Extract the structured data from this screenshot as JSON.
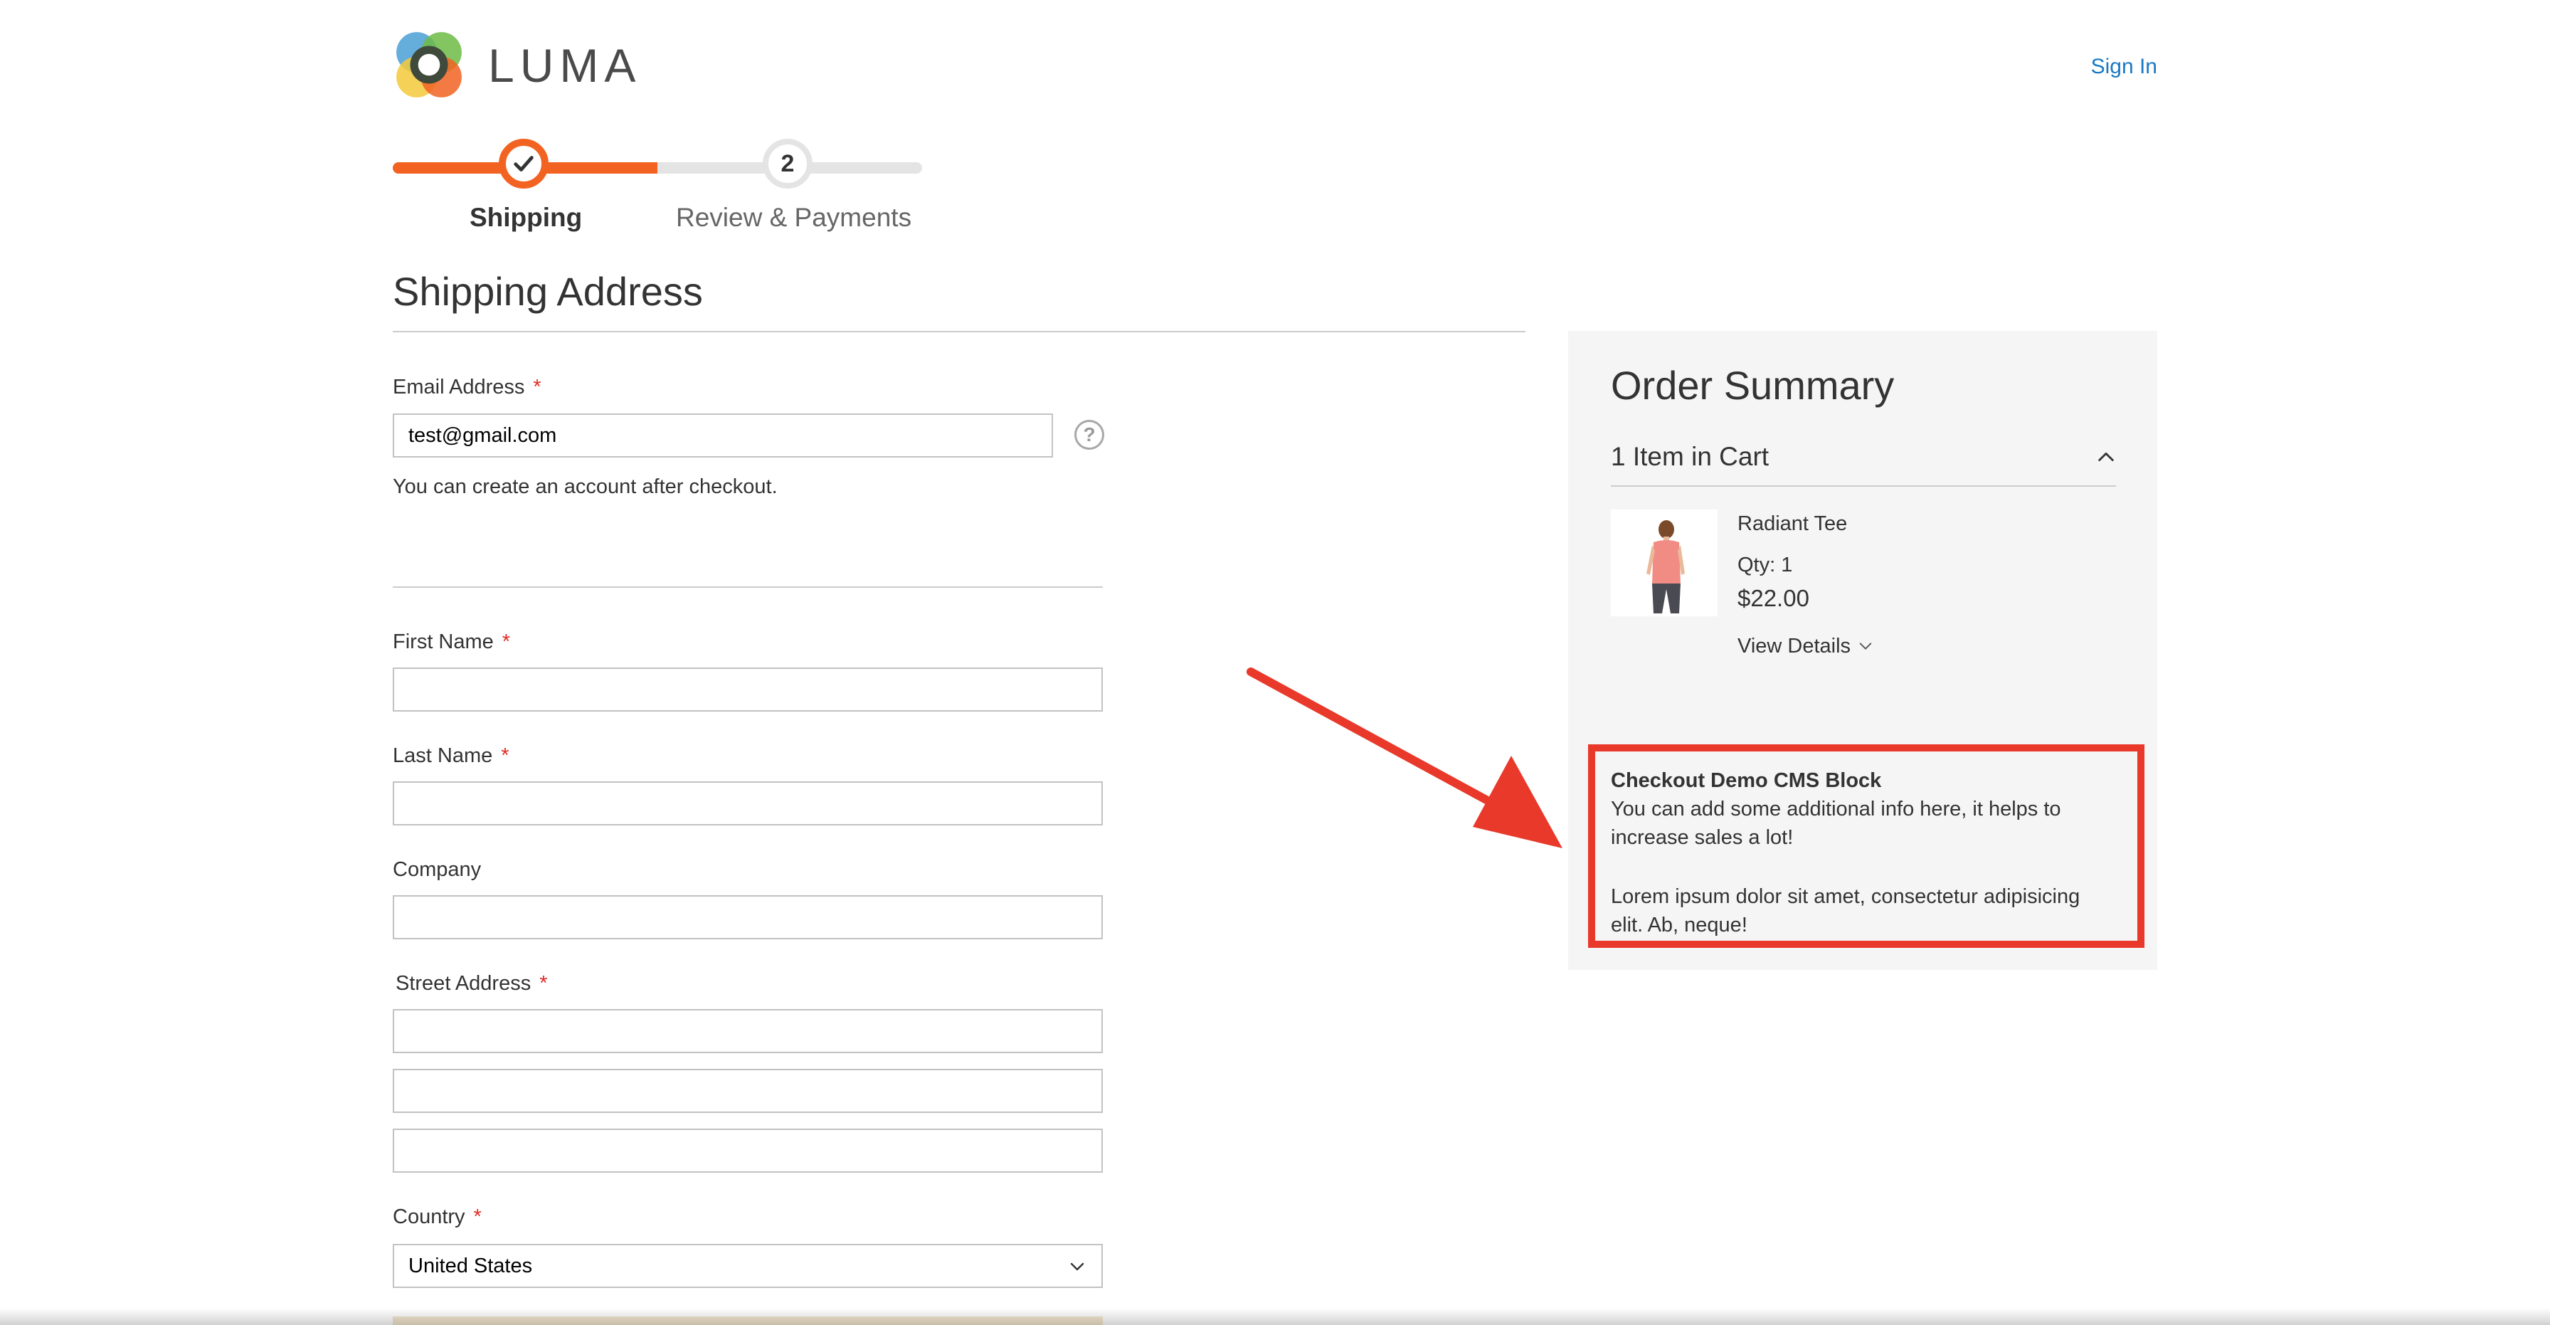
{
  "header": {
    "logo_text": "LUMA",
    "sign_in": "Sign In"
  },
  "progress": {
    "steps": [
      {
        "label": "Shipping",
        "state": "complete"
      },
      {
        "number": "2",
        "label": "Review & Payments",
        "state": "pending"
      }
    ],
    "accent_color": "#f26322"
  },
  "shipping": {
    "title": "Shipping Address",
    "email": {
      "label": "Email Address",
      "required": "*",
      "value": "test@gmail.com",
      "help": "?",
      "note": "You can create an account after checkout."
    },
    "first_name": {
      "label": "First Name",
      "required": "*",
      "value": ""
    },
    "last_name": {
      "label": "Last Name",
      "required": "*",
      "value": ""
    },
    "company": {
      "label": "Company",
      "value": ""
    },
    "street": {
      "label": "Street Address",
      "required": "*",
      "lines": [
        "",
        "",
        ""
      ]
    },
    "country": {
      "label": "Country",
      "required": "*",
      "value": "United States"
    }
  },
  "summary": {
    "title": "Order Summary",
    "cart_count": "1 Item in Cart",
    "item": {
      "name": "Radiant Tee",
      "qty": "Qty: 1",
      "price": "$22.00",
      "view_details": "View Details"
    }
  },
  "cms_block": {
    "title": "Checkout Demo CMS Block",
    "line1": "You can add some additional info here, it helps to",
    "line2": "increase sales a lot!",
    "line3": "Lorem ipsum dolor sit amet, consectetur adipisicing",
    "line4": "elit. Ab, neque!",
    "highlight_color": "#e8392b"
  },
  "colors": {
    "link": "#1979c3",
    "required": "#e02b27"
  }
}
